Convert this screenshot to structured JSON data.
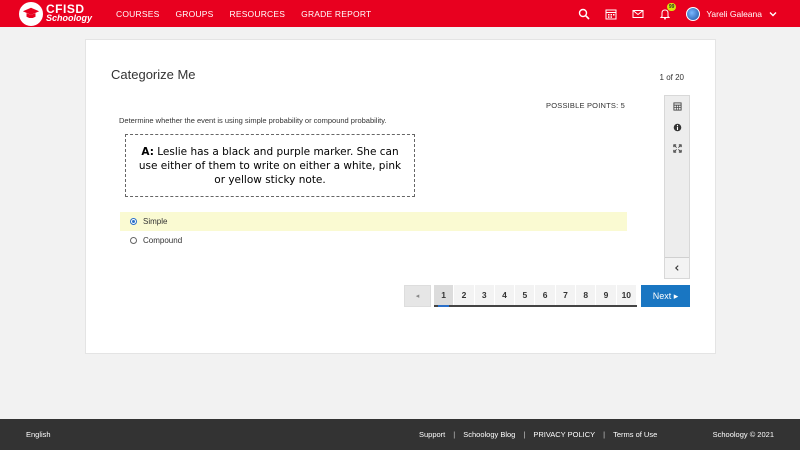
{
  "header": {
    "logo_line1": "CFISD",
    "logo_line2": "Schoology",
    "nav": [
      "COURSES",
      "GROUPS",
      "RESOURCES",
      "GRADE REPORT"
    ],
    "notification_count": "99",
    "user_name": "Yareli Galeana",
    "icons": [
      "search-icon",
      "calendar-icon",
      "mail-icon",
      "bell-icon",
      "chevron-down-icon"
    ]
  },
  "assessment": {
    "title": "Categorize Me",
    "page_indicator": "1 of 20",
    "points_label": "POSSIBLE POINTS: 5",
    "question": "Determine whether the event is using simple probability or compound probability.",
    "image_label": "A:",
    "image_text": " Leslie has a black and purple marker.  She can use either of them to write on either a white, pink or yellow sticky note.",
    "options": [
      {
        "label": "Simple",
        "selected": true
      },
      {
        "label": "Compound",
        "selected": false
      }
    ]
  },
  "tools": [
    "calculator-icon",
    "info-icon",
    "expand-icon",
    "collapse-left-icon"
  ],
  "pagination": {
    "prev_label": "◂",
    "pages": [
      "1",
      "2",
      "3",
      "4",
      "5",
      "6",
      "7",
      "8",
      "9",
      "10"
    ],
    "current": "1",
    "next_label": "Next ▸"
  },
  "footer": {
    "language": "English",
    "links": [
      "Support",
      "Schoology Blog",
      "PRIVACY POLICY",
      "Terms of Use"
    ],
    "separator": "|",
    "copyright": "Schoology © 2021"
  },
  "colors": {
    "brand_red": "#e8001f",
    "accent_blue": "#1976c2",
    "selected_option_bg": "#fafad2",
    "footer_bg": "#333333"
  }
}
